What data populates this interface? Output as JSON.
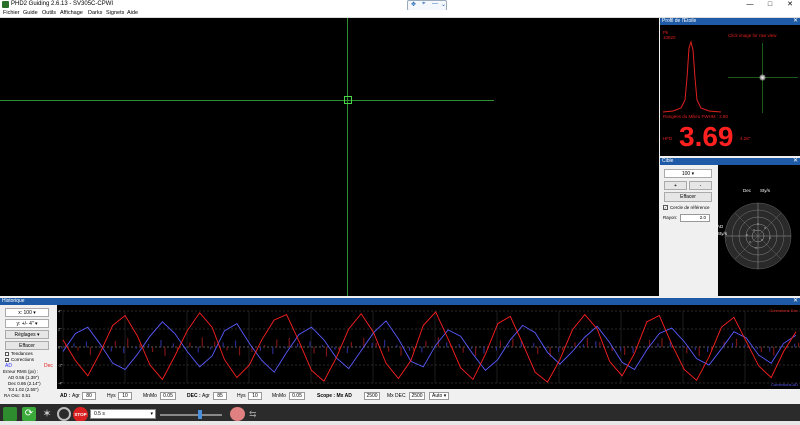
{
  "window": {
    "title": "PHD2 Guiding 2.6.13 - SV305C-CPWI",
    "minimize": "—",
    "maximize": "□",
    "close": "✕"
  },
  "menu": [
    "Fichier",
    "Guide",
    "Outils",
    "Affichage",
    "Darks",
    "Signets",
    "Aide"
  ],
  "star_profile": {
    "header": "Profil de l'Étoile",
    "pk_label": "Pk",
    "pk_value": "10820",
    "click_hint": "Click image for raw view",
    "fwhm_label": "Rangées du Milieu FWHM : 2.80",
    "hfd_label": "HFD",
    "hfd_value": "3.69",
    "hfd_unit": "4.28\""
  },
  "target": {
    "header": "Cible",
    "scale_value": "100",
    "plus": "+",
    "minus": "-",
    "clear": "Effacer",
    "ref_circle": "Cercle de référence",
    "radius_label": "Rayon:",
    "radius_value": "2.0",
    "dec_label": "Dec",
    "ra_label": "AD",
    "star_label": "Sty/s"
  },
  "history": {
    "header": "Historique",
    "x_scale": "x: 100",
    "y_scale": "y: +/- 4\"",
    "settings": "Réglages",
    "clear": "Effacer",
    "trends": "Tendances",
    "corrections": "Corrections",
    "ad_legend": "AD",
    "dec_legend": "Dec",
    "rms_title": "Erreur RMS (px) :",
    "rms_ad": "AD 0.56 (1.39\")",
    "rms_dec": "Dec 0.86 (2.14\")",
    "rms_tot": "Tot 1.02 (2.55\")",
    "ra_osc": "RA Osc: 0.51",
    "y_ticks": [
      "4\"",
      "2\"",
      "0\"",
      "-2\"",
      "-4\""
    ],
    "top_right": "Corrections Dec",
    "bottom_right": "Corrections AD"
  },
  "controls": {
    "ad_label": "AD :",
    "agr_label": "Agr",
    "ad_agr": "80",
    "hys_label": "Hys",
    "ad_hys": "10",
    "minmo_label": "MnMo",
    "ad_minmo": "0.05",
    "dec_label": "DEC :",
    "dec_agr": "85",
    "dec_hys": "10",
    "dec_minmo": "0.05",
    "scope_label": "Scope : Mx AD",
    "mx_ad": "2500",
    "mx_dec_label": "Mx DEC",
    "mx_dec": "2500",
    "dec_mode": "Auto"
  },
  "bottombar": {
    "exposure": "0.5 s",
    "stop": "STOP"
  },
  "chart_data": {
    "type": "line",
    "ylim": [
      -4,
      4
    ],
    "series": [
      {
        "name": "AD",
        "color": "#5a5aff",
        "values": [
          -0.5,
          1.5,
          2.2,
          0.3,
          -1.8,
          -2.5,
          -0.8,
          1.2,
          2.8,
          1.5,
          -0.5,
          -2.2,
          -1.0,
          1.8,
          2.6,
          0.4,
          -1.5,
          -2.8,
          -0.6,
          1.4,
          2.2,
          0.8,
          -1.2,
          -2.4,
          -0.4,
          1.6,
          2.9,
          0.9,
          -1.6,
          -2.2,
          0.2,
          1.9,
          1.2,
          -0.8,
          -2.6,
          -1.4,
          0.8,
          2.4,
          1.6,
          -0.6,
          -1.9,
          -0.5,
          1.1,
          2.3,
          0.5,
          -1.7,
          -2.5,
          -0.3,
          1.5,
          2.1,
          0.6,
          -1.3,
          -2.0,
          -0.2,
          1.7,
          1.0,
          -0.9,
          -1.8,
          0.4,
          1.3
        ]
      },
      {
        "name": "Dec",
        "color": "#ff2020",
        "values": [
          0.8,
          -1.5,
          -3.2,
          -0.6,
          2.4,
          3.5,
          1.2,
          -2.0,
          -3.6,
          -1.0,
          1.8,
          3.8,
          2.2,
          -1.4,
          -3.4,
          -2.0,
          0.8,
          3.0,
          3.6,
          0.6,
          -2.6,
          -3.8,
          -1.2,
          2.0,
          3.7,
          1.6,
          -1.8,
          -3.5,
          -1.5,
          2.4,
          3.9,
          0.9,
          -2.3,
          -3.6,
          -0.8,
          2.6,
          3.4,
          0.4,
          -2.8,
          -3.9,
          -1.4,
          1.9,
          3.6,
          2.0,
          -1.6,
          -3.2,
          -0.7,
          2.8,
          3.5,
          0.3,
          -2.5,
          -3.7,
          -1.1,
          2.2,
          3.3,
          0.6,
          -2.1,
          -3.4,
          -0.5,
          1.7
        ]
      }
    ]
  }
}
